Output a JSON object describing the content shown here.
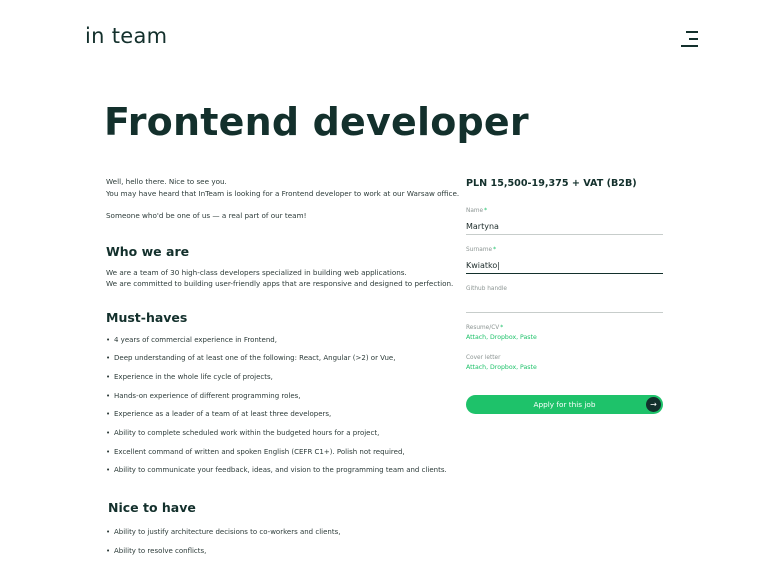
{
  "header": {
    "logo": "in team",
    "menu_icon": "hamburger-menu-icon"
  },
  "job": {
    "title": "Frontend developer",
    "intro": [
      "Well, hello there. Nice to see you.",
      "You may have heard that InTeam is looking for a Frontend developer to work at our Warsaw office.",
      "Someone who'd be one of us — a real part of our team!"
    ],
    "who_we_are": {
      "heading": "Who we are",
      "lines": [
        "We are a team of 30 high-class developers specialized in building web applications.",
        "We are committed to building user-friendly apps that are responsive and designed to perfection."
      ]
    },
    "must_haves": {
      "heading": "Must-haves",
      "items": [
        "4 years of commercial experience in Frontend,",
        "Deep understanding of at least one of the following: React, Angular (>2) or Vue,",
        "Experience in the whole life cycle of projects,",
        "Hands-on experience of different programming roles,",
        "Experience as a leader of a team of at least three developers,",
        "Ability to complete scheduled work within the budgeted hours for a project,",
        "Excellent command of written and spoken English (CEFR C1+). Polish not required,",
        "Ability to communicate your feedback, ideas, and vision to the programming team and clients."
      ]
    },
    "nice_to_have": {
      "heading": "Nice to have",
      "items": [
        "Ability to justify architecture decisions to co-workers and clients,",
        "Ability to resolve conflicts,"
      ]
    }
  },
  "form": {
    "salary": "PLN 15,500-19,375 + VAT (B2B)",
    "name": {
      "label": "Name",
      "required": "*",
      "value": "Martyna"
    },
    "surname": {
      "label": "Surname",
      "required": "*",
      "value": "Kwiatko|"
    },
    "github": {
      "label": "Github handle",
      "value": ""
    },
    "resume": {
      "label": "Resume/CV",
      "required": "*",
      "attach": "Attach",
      "dropbox": "Dropbox",
      "paste": "Paste"
    },
    "cover_letter": {
      "label": "Cover letter",
      "attach": "Attach",
      "dropbox": "Dropbox",
      "paste": "Paste"
    },
    "apply_label": "Apply for this job",
    "apply_arrow": "→",
    "colors": {
      "accent": "#1ec26a",
      "dark": "#13302c"
    }
  }
}
